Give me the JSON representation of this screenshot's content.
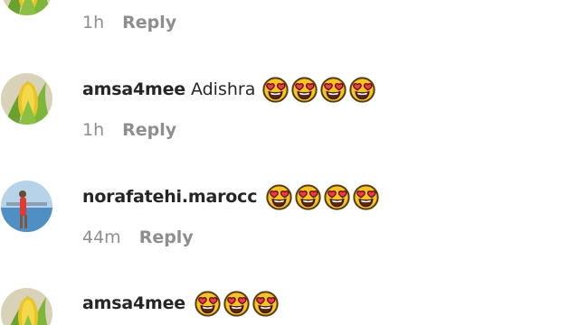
{
  "comments": [
    {
      "username": "",
      "text": "",
      "emoji_count": 0,
      "time": "1h",
      "reply_label": "Reply",
      "avatar": "corn-avatar"
    },
    {
      "username": "amsa4mee",
      "text": "Adishra",
      "emoji_count": 4,
      "emoji": "heart-eyes-emoji",
      "time": "1h",
      "reply_label": "Reply",
      "avatar": "corn-avatar"
    },
    {
      "username": "norafatehi.marocc",
      "text": "",
      "emoji_count": 4,
      "emoji": "heart-eyes-emoji",
      "time": "44m",
      "reply_label": "Reply",
      "avatar": "person-beach-avatar"
    },
    {
      "username": "amsa4mee",
      "text": "",
      "emoji_count": 3,
      "emoji": "heart-eyes-emoji",
      "time": "",
      "reply_label": "",
      "avatar": "corn-avatar"
    }
  ],
  "colors": {
    "username": "#262626",
    "meta": "#8e8e8e",
    "emoji_face": "#f7c325",
    "emoji_heart": "#ef3b45"
  }
}
